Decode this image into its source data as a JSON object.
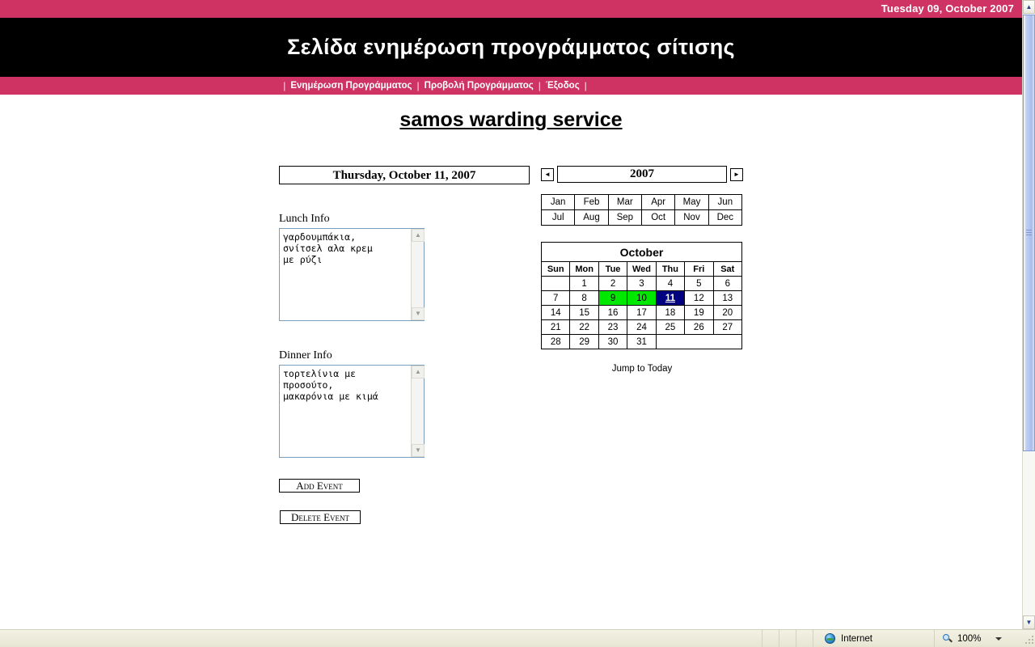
{
  "topbar": {
    "date": "Tuesday 09, October 2007"
  },
  "header": {
    "title": "Σελίδα ενημέρωση προγράμματος σίτισης"
  },
  "nav": {
    "separator": "|",
    "items": [
      {
        "label": "Ενημέρωση Προγράμματος"
      },
      {
        "label": "Προβολή Προγράμματος"
      },
      {
        "label": "Έξοδος"
      }
    ]
  },
  "page": {
    "title": "samos warding service"
  },
  "form": {
    "selected_date": "Thursday, October 11, 2007",
    "lunch_label": "Lunch Info",
    "lunch_value": "γαρδουμπάκια,\nσνίτσελ αλα κρεμ\nμε ρύζι",
    "dinner_label": "Dinner Info",
    "dinner_value": "τορτελίνια με\nπροσούτο,\nμακαρόνια με κιμά",
    "add_button": "Add Event",
    "delete_button": "Delete Event"
  },
  "calendar": {
    "year": "2007",
    "prev_year_icon": "◄",
    "next_year_icon": "►",
    "months": [
      "Jan",
      "Feb",
      "Mar",
      "Apr",
      "May",
      "Jun",
      "Jul",
      "Aug",
      "Sep",
      "Oct",
      "Nov",
      "Dec"
    ],
    "current_month": "October",
    "weekdays": [
      "Sun",
      "Mon",
      "Tue",
      "Wed",
      "Thu",
      "Fri",
      "Sat"
    ],
    "weeks": [
      [
        {
          "day": ""
        },
        {
          "day": "1"
        },
        {
          "day": "2"
        },
        {
          "day": "3"
        },
        {
          "day": "4"
        },
        {
          "day": "5"
        },
        {
          "day": "6"
        }
      ],
      [
        {
          "day": "7"
        },
        {
          "day": "8"
        },
        {
          "day": "9",
          "state": "green"
        },
        {
          "day": "10",
          "state": "green"
        },
        {
          "day": "11",
          "state": "selected"
        },
        {
          "day": "12"
        },
        {
          "day": "13"
        }
      ],
      [
        {
          "day": "14"
        },
        {
          "day": "15"
        },
        {
          "day": "16"
        },
        {
          "day": "17"
        },
        {
          "day": "18"
        },
        {
          "day": "19"
        },
        {
          "day": "20"
        }
      ],
      [
        {
          "day": "21"
        },
        {
          "day": "22"
        },
        {
          "day": "23"
        },
        {
          "day": "24"
        },
        {
          "day": "25"
        },
        {
          "day": "26"
        },
        {
          "day": "27"
        }
      ],
      [
        {
          "day": "28"
        },
        {
          "day": "29"
        },
        {
          "day": "30"
        },
        {
          "day": "31"
        },
        {
          "day": ""
        },
        {
          "day": ""
        },
        {
          "day": ""
        }
      ]
    ],
    "jump_to_today": "Jump to Today",
    "colors": {
      "event_day": "#00e800",
      "selected_day": "#000080",
      "accent": "#ce3364"
    }
  },
  "scrollbar": {
    "up_icon": "▲",
    "down_icon": "▼"
  },
  "statusbar": {
    "zone": "Internet",
    "zoom": "100%",
    "globe_icon": "globe-icon",
    "zoom_icon": "magnifier-icon"
  }
}
